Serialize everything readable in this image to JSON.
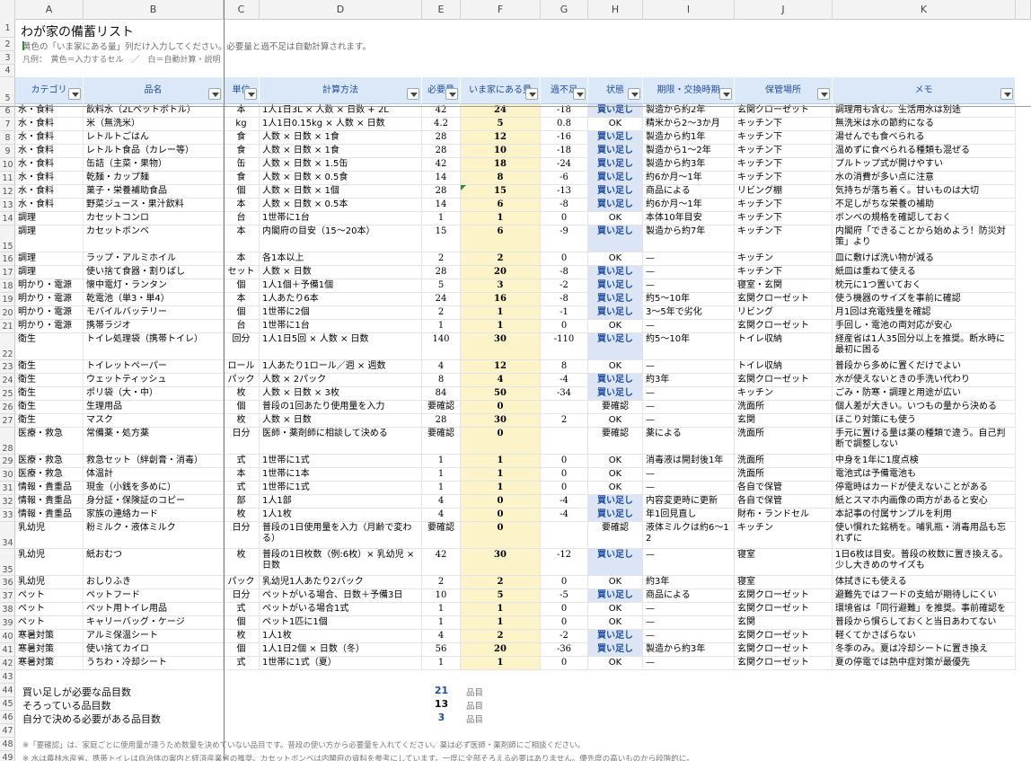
{
  "columns": [
    "A",
    "B",
    "C",
    "D",
    "E",
    "F",
    "G",
    "H",
    "I",
    "J",
    "K"
  ],
  "title": "わが家の備蓄リスト",
  "subtitle": "黄色の「いま家にある量」列だけ入力してください。必要量と過不足は自動計算されます。",
  "legend": "凡例：　黄色＝入力するセル　／　白＝自動計算・説明",
  "headers": [
    "カテゴリ",
    "品名",
    "単位",
    "計算方法",
    "必要量",
    "いま家にある量",
    "過不足",
    "状態",
    "期限・交換時期",
    "保管場所",
    "メモ"
  ],
  "rows": [
    {
      "n": "6",
      "cat": "水・食料",
      "item": "飲料水（2Lペットボトル）",
      "unit": "本",
      "calc": "1人1日3L × 人数 × 日数 + 2L",
      "need": "42",
      "have": "24",
      "diff": "-18",
      "status": "買い足し",
      "limit": "製造から約2年",
      "place": "玄関クローゼット",
      "memo": "調理用も含む。生活用水は別途"
    },
    {
      "n": "7",
      "cat": "水・食料",
      "item": "米（無洗米）",
      "unit": "kg",
      "calc": "1人1日0.15kg × 人数 × 日数",
      "need": "4.2",
      "have": "5",
      "diff": "0.8",
      "status": "OK",
      "limit": "精米から2〜3か月",
      "place": "キッチン下",
      "memo": "無洗米は水の節約になる"
    },
    {
      "n": "8",
      "cat": "水・食料",
      "item": "レトルトごはん",
      "unit": "食",
      "calc": "人数 × 日数 × 1食",
      "need": "28",
      "have": "12",
      "diff": "-16",
      "status": "買い足し",
      "limit": "製造から約1年",
      "place": "キッチン下",
      "memo": "湯せんでも食べられる"
    },
    {
      "n": "9",
      "cat": "水・食料",
      "item": "レトルト食品（カレー等）",
      "unit": "食",
      "calc": "人数 × 日数 × 1食",
      "need": "28",
      "have": "10",
      "diff": "-18",
      "status": "買い足し",
      "limit": "製造から1〜2年",
      "place": "キッチン下",
      "memo": "温めずに食べられる種類も混ぜる"
    },
    {
      "n": "10",
      "cat": "水・食料",
      "item": "缶詰（主菜・果物）",
      "unit": "缶",
      "calc": "人数 × 日数 × 1.5缶",
      "need": "42",
      "have": "18",
      "diff": "-24",
      "status": "買い足し",
      "limit": "製造から約3年",
      "place": "キッチン下",
      "memo": "プルトップ式が開けやすい"
    },
    {
      "n": "11",
      "cat": "水・食料",
      "item": "乾麺・カップ麺",
      "unit": "食",
      "calc": "人数 × 日数 × 0.5食",
      "need": "14",
      "have": "8",
      "diff": "-6",
      "status": "買い足し",
      "limit": "約6か月〜1年",
      "place": "キッチン下",
      "memo": "水の消費が多い点に注意"
    },
    {
      "n": "12",
      "cat": "水・食料",
      "item": "菓子・栄養補助食品",
      "unit": "個",
      "calc": "人数 × 日数 × 1個",
      "need": "28",
      "have": "15",
      "diff": "-13",
      "status": "買い足し",
      "limit": "商品による",
      "place": "リビング棚",
      "memo": "気持ちが落ち着く。甘いものは大切"
    },
    {
      "n": "13",
      "cat": "水・食料",
      "item": "野菜ジュース・果汁飲料",
      "unit": "本",
      "calc": "人数 × 日数 × 0.5本",
      "need": "14",
      "have": "6",
      "diff": "-8",
      "status": "買い足し",
      "limit": "約6か月〜1年",
      "place": "キッチン下",
      "memo": "不足しがちな栄養の補助"
    },
    {
      "n": "14",
      "cat": "調理",
      "item": "カセットコンロ",
      "unit": "台",
      "calc": "1世帯に1台",
      "need": "1",
      "have": "1",
      "diff": "0",
      "status": "OK",
      "limit": "本体10年目安",
      "place": "キッチン下",
      "memo": "ボンベの規格を確認しておく"
    },
    {
      "n": "15",
      "cat": "調理",
      "item": "カセットボンベ",
      "unit": "本",
      "calc": "内閣府の目安（15〜20本）",
      "need": "15",
      "have": "6",
      "diff": "-9",
      "status": "買い足し",
      "limit": "製造から約7年",
      "place": "キッチン下",
      "memo": "内閣府「できることから始めよう！防災対策」より",
      "tall": true
    },
    {
      "n": "16",
      "cat": "調理",
      "item": "ラップ・アルミホイル",
      "unit": "本",
      "calc": "各1本以上",
      "need": "2",
      "have": "2",
      "diff": "0",
      "status": "OK",
      "limit": "—",
      "place": "キッチン",
      "memo": "皿に敷けば洗い物が減る"
    },
    {
      "n": "17",
      "cat": "調理",
      "item": "使い捨て食器・割りばし",
      "unit": "セット",
      "calc": "人数 × 日数",
      "need": "28",
      "have": "20",
      "diff": "-8",
      "status": "買い足し",
      "limit": "—",
      "place": "キッチン下",
      "memo": "紙皿は重ねて使える"
    },
    {
      "n": "18",
      "cat": "明かり・電源",
      "item": "懐中電灯・ランタン",
      "unit": "個",
      "calc": "1人1個＋予備1個",
      "need": "5",
      "have": "3",
      "diff": "-2",
      "status": "買い足し",
      "limit": "—",
      "place": "寝室・玄関",
      "memo": "枕元に1つ置いておく"
    },
    {
      "n": "19",
      "cat": "明かり・電源",
      "item": "乾電池（単3・単4）",
      "unit": "本",
      "calc": "1人あたり6本",
      "need": "24",
      "have": "16",
      "diff": "-8",
      "status": "買い足し",
      "limit": "約5〜10年",
      "place": "玄関クローゼット",
      "memo": "使う機器のサイズを事前に確認"
    },
    {
      "n": "20",
      "cat": "明かり・電源",
      "item": "モバイルバッテリー",
      "unit": "個",
      "calc": "1世帯に2個",
      "need": "2",
      "have": "1",
      "diff": "-1",
      "status": "買い足し",
      "limit": "3〜5年で劣化",
      "place": "リビング",
      "memo": "月1回は充電残量を確認"
    },
    {
      "n": "21",
      "cat": "明かり・電源",
      "item": "携帯ラジオ",
      "unit": "台",
      "calc": "1世帯に1台",
      "need": "1",
      "have": "1",
      "diff": "0",
      "status": "OK",
      "limit": "—",
      "place": "玄関クローゼット",
      "memo": "手回し・電池の両対応が安心"
    },
    {
      "n": "22",
      "cat": "衛生",
      "item": "トイレ処理袋（携帯トイレ）",
      "unit": "回分",
      "calc": "1人1日5回 × 人数 × 日数",
      "need": "140",
      "have": "30",
      "diff": "-110",
      "status": "買い足し",
      "limit": "約5〜10年",
      "place": "トイレ収納",
      "memo": "経産省は1人35回分以上を推奨。断水時に最初に困る",
      "tall": true
    },
    {
      "n": "23",
      "cat": "衛生",
      "item": "トイレットペーパー",
      "unit": "ロール",
      "calc": "1人あたり1ロール／週 × 週数",
      "need": "4",
      "have": "12",
      "diff": "8",
      "status": "OK",
      "limit": "—",
      "place": "トイレ収納",
      "memo": "普段から多めに置くだけでよい"
    },
    {
      "n": "24",
      "cat": "衛生",
      "item": "ウェットティッシュ",
      "unit": "パック",
      "calc": "人数 × 2パック",
      "need": "8",
      "have": "4",
      "diff": "-4",
      "status": "買い足し",
      "limit": "約3年",
      "place": "玄関クローゼット",
      "memo": "水が使えないときの手洗い代わり"
    },
    {
      "n": "25",
      "cat": "衛生",
      "item": "ポリ袋（大・中）",
      "unit": "枚",
      "calc": "人数 × 日数 × 3枚",
      "need": "84",
      "have": "50",
      "diff": "-34",
      "status": "買い足し",
      "limit": "—",
      "place": "キッチン",
      "memo": "ごみ・防寒・調理と用途が広い"
    },
    {
      "n": "26",
      "cat": "衛生",
      "item": "生理用品",
      "unit": "個",
      "calc": "普段の1回あたり使用量を入力",
      "need": "要確認",
      "have": "0",
      "diff": "",
      "status": "要確認",
      "limit": "—",
      "place": "洗面所",
      "memo": "個人差が大きい。いつもの量から決める"
    },
    {
      "n": "27",
      "cat": "衛生",
      "item": "マスク",
      "unit": "枚",
      "calc": "人数 × 日数",
      "need": "28",
      "have": "30",
      "diff": "2",
      "status": "OK",
      "limit": "—",
      "place": "玄関",
      "memo": "ほこり対策にも使う"
    },
    {
      "n": "28",
      "cat": "医療・救急",
      "item": "常備薬・処方薬",
      "unit": "日分",
      "calc": "医師・薬剤師に相談して決める",
      "need": "要確認",
      "have": "0",
      "diff": "",
      "status": "要確認",
      "limit": "薬による",
      "place": "洗面所",
      "memo": "手元に置ける量は薬の種類で違う。自己判断で調整しない",
      "tall": true
    },
    {
      "n": "29",
      "cat": "医療・救急",
      "item": "救急セット（絆創膏・消毒）",
      "unit": "式",
      "calc": "1世帯に1式",
      "need": "1",
      "have": "1",
      "diff": "0",
      "status": "OK",
      "limit": "消毒液は開封後1年",
      "place": "洗面所",
      "memo": "中身を1年に1度点検"
    },
    {
      "n": "30",
      "cat": "医療・救急",
      "item": "体温計",
      "unit": "本",
      "calc": "1世帯に1本",
      "need": "1",
      "have": "1",
      "diff": "0",
      "status": "OK",
      "limit": "—",
      "place": "洗面所",
      "memo": "電池式は予備電池も"
    },
    {
      "n": "31",
      "cat": "情報・貴重品",
      "item": "現金（小銭を多めに）",
      "unit": "式",
      "calc": "1世帯に1式",
      "need": "1",
      "have": "1",
      "diff": "0",
      "status": "OK",
      "limit": "—",
      "place": "各自で保管",
      "memo": "停電時はカードが使えないことがある"
    },
    {
      "n": "32",
      "cat": "情報・貴重品",
      "item": "身分証・保険証のコピー",
      "unit": "部",
      "calc": "1人1部",
      "need": "4",
      "have": "0",
      "diff": "-4",
      "status": "買い足し",
      "limit": "内容変更時に更新",
      "place": "各自で保管",
      "memo": "紙とスマホ内画像の両方があると安心"
    },
    {
      "n": "33",
      "cat": "情報・貴重品",
      "item": "家族の連絡カード",
      "unit": "枚",
      "calc": "1人1枚",
      "need": "4",
      "have": "0",
      "diff": "-4",
      "status": "買い足し",
      "limit": "年1回見直し",
      "place": "財布・ランドセル",
      "memo": "本記事の付属サンプルを利用"
    },
    {
      "n": "34",
      "cat": "乳幼児",
      "item": "粉ミルク・液体ミルク",
      "unit": "日分",
      "calc": "普段の1日使用量を入力（月齢で変わる）",
      "need": "要確認",
      "have": "0",
      "diff": "",
      "status": "要確認",
      "limit": "液体ミルクは約6〜12",
      "place": "キッチン",
      "memo": "使い慣れた銘柄を。哺乳瓶・消毒用品も忘れずに",
      "tall": true
    },
    {
      "n": "35",
      "cat": "乳幼児",
      "item": "紙おむつ",
      "unit": "枚",
      "calc": "普段の1日枚数（例:6枚）× 乳幼児 × 日数",
      "need": "42",
      "have": "30",
      "diff": "-12",
      "status": "買い足し",
      "limit": "—",
      "place": "寝室",
      "memo": "1日6枚は目安。普段の枚数に置き換える。少し大きめのサイズも",
      "tall": true
    },
    {
      "n": "36",
      "cat": "乳幼児",
      "item": "おしりふき",
      "unit": "パック",
      "calc": "乳幼児1人あたり2パック",
      "need": "2",
      "have": "2",
      "diff": "0",
      "status": "OK",
      "limit": "約3年",
      "place": "寝室",
      "memo": "体拭きにも使える"
    },
    {
      "n": "37",
      "cat": "ペット",
      "item": "ペットフード",
      "unit": "日分",
      "calc": "ペットがいる場合、日数＋予備3日",
      "need": "10",
      "have": "5",
      "diff": "-5",
      "status": "買い足し",
      "limit": "商品による",
      "place": "玄関クローゼット",
      "memo": "避難先ではフードの支給が期待しにくい"
    },
    {
      "n": "38",
      "cat": "ペット",
      "item": "ペット用トイレ用品",
      "unit": "式",
      "calc": "ペットがいる場合1式",
      "need": "1",
      "have": "1",
      "diff": "0",
      "status": "OK",
      "limit": "—",
      "place": "玄関クローゼット",
      "memo": "環境省は「同行避難」を推奨。事前確認を"
    },
    {
      "n": "39",
      "cat": "ペット",
      "item": "キャリーバッグ・ケージ",
      "unit": "個",
      "calc": "ペット1匹に1個",
      "need": "1",
      "have": "1",
      "diff": "0",
      "status": "OK",
      "limit": "—",
      "place": "玄関",
      "memo": "普段から慣らしておくと当日あわてない"
    },
    {
      "n": "40",
      "cat": "寒暑対策",
      "item": "アルミ保温シート",
      "unit": "枚",
      "calc": "1人1枚",
      "need": "4",
      "have": "2",
      "diff": "-2",
      "status": "買い足し",
      "limit": "—",
      "place": "玄関クローゼット",
      "memo": "軽くてかさばらない"
    },
    {
      "n": "41",
      "cat": "寒暑対策",
      "item": "使い捨てカイロ",
      "unit": "個",
      "calc": "1人1日2個 × 日数（冬）",
      "need": "56",
      "have": "20",
      "diff": "-36",
      "status": "買い足し",
      "limit": "製造から約3年",
      "place": "玄関クローゼット",
      "memo": "冬季のみ。夏は冷却シートに置き換え"
    },
    {
      "n": "42",
      "cat": "寒暑対策",
      "item": "うちわ・冷却シート",
      "unit": "式",
      "calc": "1世帯に1式（夏）",
      "need": "1",
      "have": "1",
      "diff": "0",
      "status": "OK",
      "limit": "—",
      "place": "玄関クローゼット",
      "memo": "夏の停電では熱中症対策が最優先"
    }
  ],
  "summary": [
    {
      "label": "買い足しが必要な品目数",
      "value": "21",
      "unit": "品目"
    },
    {
      "label": "そろっている品目数",
      "value": "13",
      "unit": "品目"
    },
    {
      "label": "自分で決める必要がある品目数",
      "value": "3",
      "unit": "品目"
    }
  ],
  "notes": [
    "※「要確認」は、家庭ごとに使用量が違うため数量を決めていない品目です。普段の使い方から必要量を入れてください。薬は必ず医師・薬剤師にご相談ください。",
    "※ 水は農林水産省、携帯トイレは自治体の案内と経済産業省の推奨、カセットボンベは内閣府の資料を参考にしています。一度に全部そろえる必要はありません。優先度の高いものから段階的に。"
  ],
  "colors": {
    "input_fill": "#fdf3c8",
    "header_fill": "#dbe8f8",
    "buy_fill": "#dbe5f5",
    "buy_text": "#1f4fa3"
  }
}
